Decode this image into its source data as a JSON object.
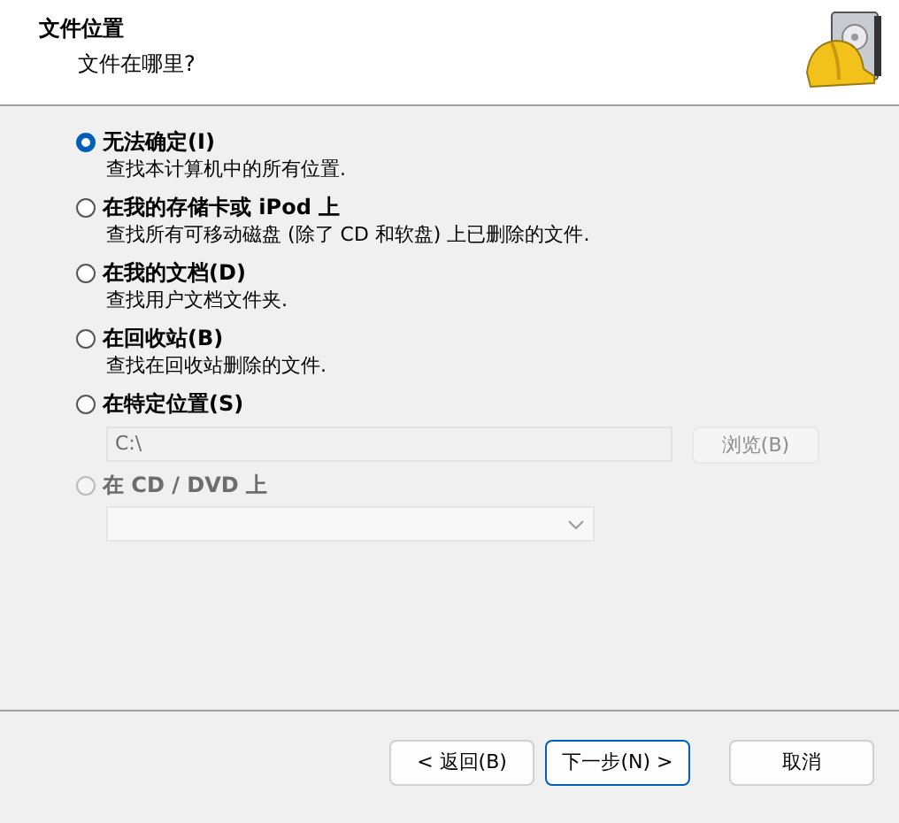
{
  "header": {
    "title": "文件位置",
    "subtitle": "文件在哪里?"
  },
  "options": [
    {
      "label": "无法确定(I)",
      "description": "查找本计算机中的所有位置.",
      "selected": true,
      "disabled": false
    },
    {
      "label": "在我的存储卡或 iPod 上",
      "description": "查找所有可移动磁盘 (除了 CD 和软盘) 上已删除的文件.",
      "selected": false,
      "disabled": false
    },
    {
      "label": "在我的文档(D)",
      "description": "查找用户文档文件夹.",
      "selected": false,
      "disabled": false
    },
    {
      "label": "在回收站(B)",
      "description": "查找在回收站删除的文件.",
      "selected": false,
      "disabled": false
    },
    {
      "label": "在特定位置(S)",
      "selected": false,
      "disabled": false,
      "path_field": {
        "value": "C:\\",
        "disabled": true
      },
      "browse_button": {
        "label": "浏览(B)",
        "disabled": true
      }
    },
    {
      "label": "在 CD / DVD 上",
      "selected": false,
      "disabled": true,
      "dropdown": {
        "disabled": true
      }
    }
  ],
  "buttons": [
    {
      "label": "< 返回(B)",
      "focused": false
    },
    {
      "label": "下一步(N) >",
      "focused": true
    },
    {
      "label": "取消",
      "focused": false
    }
  ]
}
